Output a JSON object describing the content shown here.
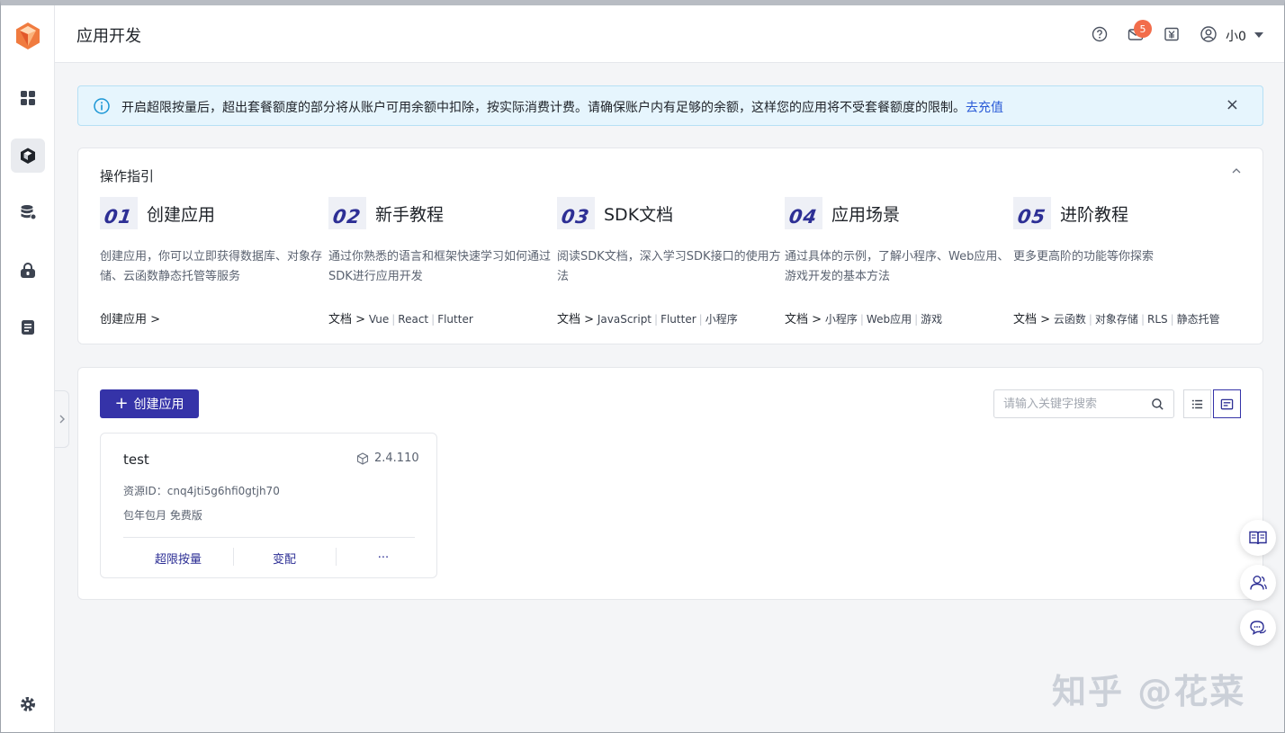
{
  "header": {
    "title": "应用开发",
    "notification_count": "5",
    "user_name": "小0"
  },
  "alert": {
    "text": "开启超限按量后，超出套餐额度的部分将从账户可用余额中扣除，按实际消费计费。请确保账户内有足够的余额，这样您的应用将不受套餐额度的限制。",
    "link": "去充值",
    "close": "×"
  },
  "guide": {
    "title": "操作指引",
    "steps": [
      {
        "num": "01",
        "name": "创建应用",
        "desc": "创建应用，你可以立即获得数据库、对象存储、云函数静态托管等服务",
        "lead": "创建应用 >",
        "links": []
      },
      {
        "num": "02",
        "name": "新手教程",
        "desc": "通过你熟悉的语言和框架快速学习如何通过SDK进行应用开发",
        "lead": "文档 >",
        "links": [
          "Vue",
          "React",
          "Flutter"
        ]
      },
      {
        "num": "03",
        "name": "SDK文档",
        "desc": "阅读SDK文档，深入学习SDK接口的使用方法",
        "lead": "文档 >",
        "links": [
          "JavaScript",
          "Flutter",
          "小程序"
        ]
      },
      {
        "num": "04",
        "name": "应用场景",
        "desc": "通过具体的示例，了解小程序、Web应用、游戏开发的基本方法",
        "lead": "文档 >",
        "links": [
          "小程序",
          "Web应用",
          "游戏"
        ]
      },
      {
        "num": "05",
        "name": "进阶教程",
        "desc": "更多更高阶的功能等你探索",
        "lead": "文档 >",
        "links": [
          "云函数",
          "对象存储",
          "RLS",
          "静态托管"
        ]
      }
    ]
  },
  "apps": {
    "create_label": "创建应用",
    "search_placeholder": "请输入关键字搜索",
    "cards": [
      {
        "name": "test",
        "version": "2.4.110",
        "resource_id": "资源ID：cnq4jti5g6hfi0gtjh70",
        "plan": "包年包月 免费版",
        "actions": [
          "超限按量",
          "变配",
          "···"
        ]
      }
    ]
  },
  "watermark": "知乎 @花菜",
  "colors": {
    "brand": "#3533a8",
    "alert_bg": "#e6f5fd",
    "badge": "#f26d4b",
    "logo": "#f07b3f"
  }
}
